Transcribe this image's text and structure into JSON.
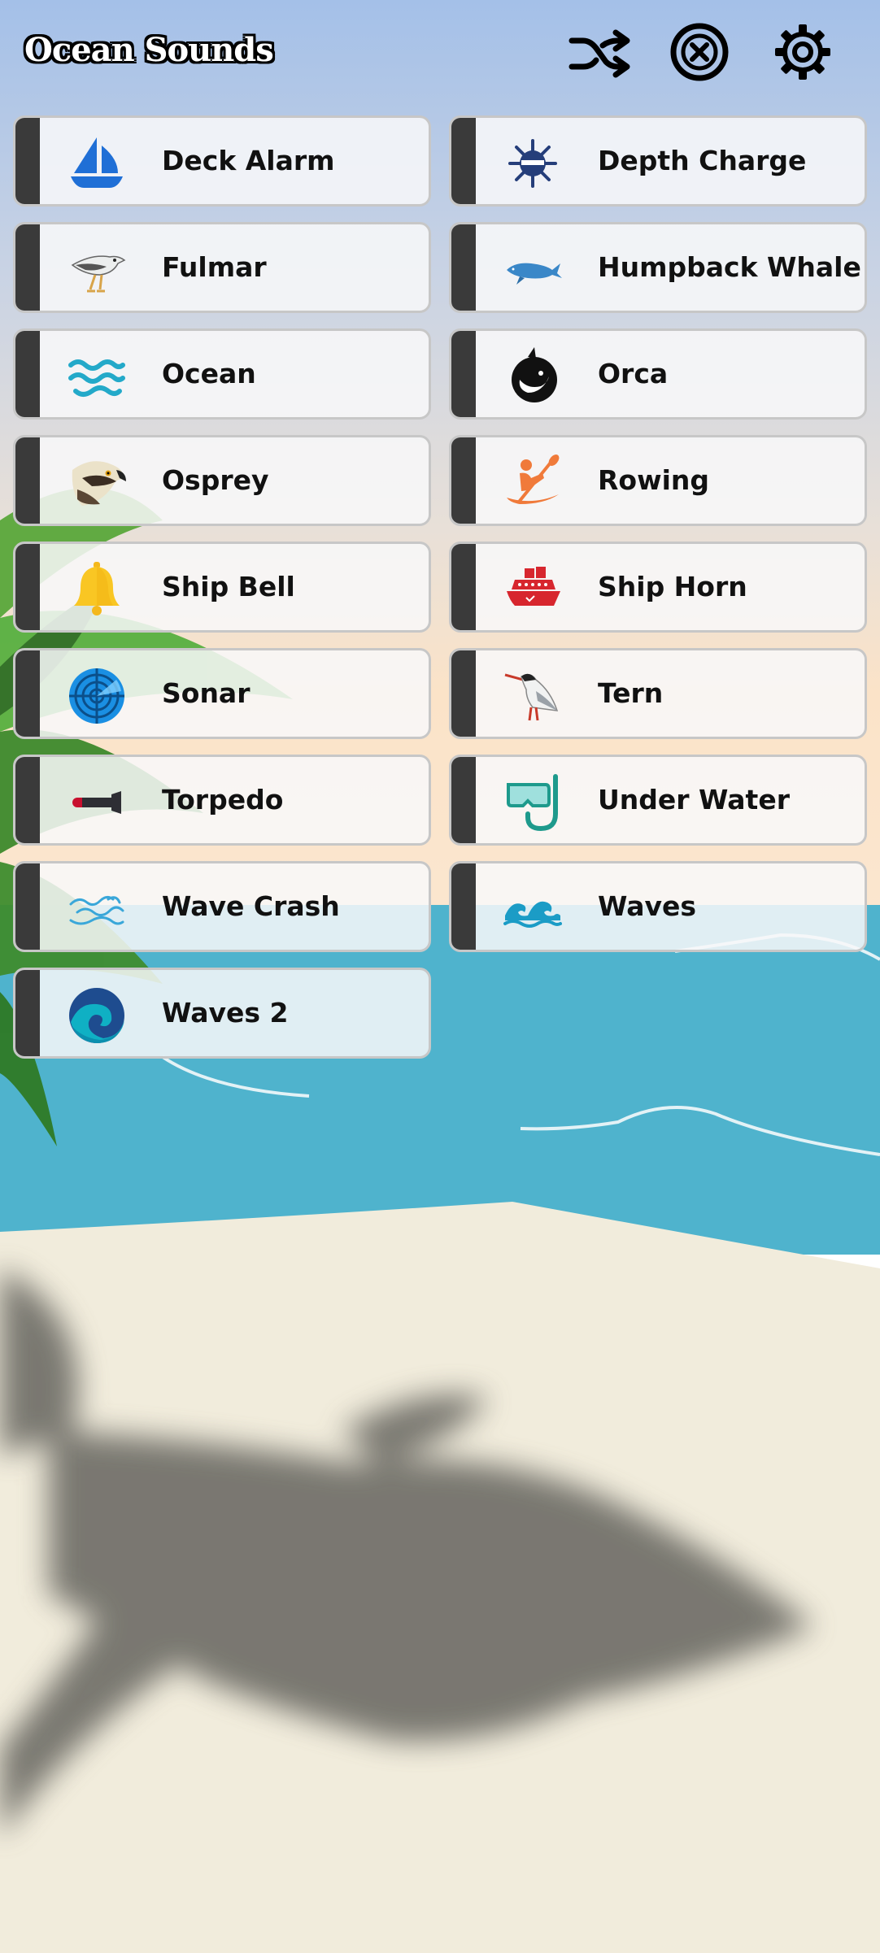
{
  "app": {
    "title": "Ocean Sounds"
  },
  "toolbar": {
    "shuffle_icon": "shuffle-icon",
    "stop_icon": "stop-circle-x-icon",
    "settings_icon": "gear-icon"
  },
  "sounds": [
    {
      "label": "Deck Alarm",
      "icon": "sailboat-icon"
    },
    {
      "label": "Depth Charge",
      "icon": "mine-icon"
    },
    {
      "label": "Fulmar",
      "icon": "fulmar-bird-icon"
    },
    {
      "label": "Humpback Whale",
      "icon": "whale-icon"
    },
    {
      "label": "Ocean",
      "icon": "ocean-waves-icon"
    },
    {
      "label": "Orca",
      "icon": "orca-icon"
    },
    {
      "label": "Osprey",
      "icon": "osprey-icon"
    },
    {
      "label": "Rowing",
      "icon": "kayak-icon"
    },
    {
      "label": "Ship Bell",
      "icon": "bell-icon"
    },
    {
      "label": "Ship Horn",
      "icon": "ship-icon"
    },
    {
      "label": "Sonar",
      "icon": "sonar-icon"
    },
    {
      "label": "Tern",
      "icon": "tern-bird-icon"
    },
    {
      "label": "Torpedo",
      "icon": "torpedo-icon"
    },
    {
      "label": "Under Water",
      "icon": "snorkel-mask-icon"
    },
    {
      "label": "Wave Crash",
      "icon": "wave-lines-icon"
    },
    {
      "label": "Waves",
      "icon": "waves-icon"
    },
    {
      "label": "Waves 2",
      "icon": "wave-circle-icon"
    }
  ],
  "colors": {
    "card_strip": "#3a3a3a",
    "card_border": "#c7c7c7",
    "sea": "#4fb3cd",
    "sand": "#f2ecdd"
  }
}
